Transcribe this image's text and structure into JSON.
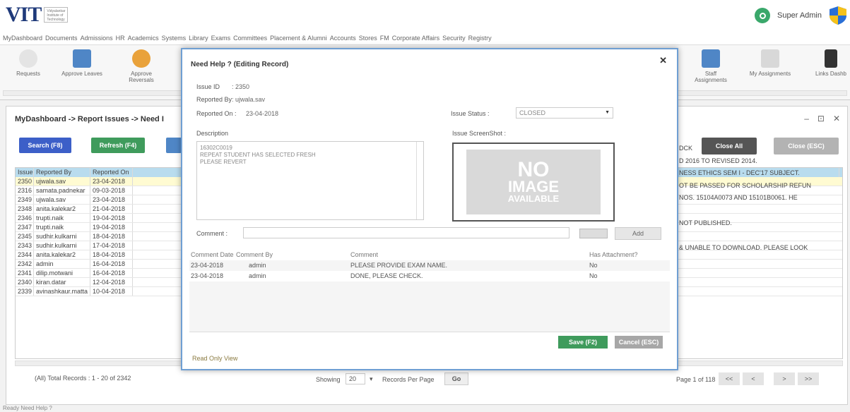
{
  "header": {
    "logo_text": "VIT",
    "logo_sub": "Vidyalankar Institute of Technology",
    "user_name": "Super Admin"
  },
  "menu": [
    "MyDashboard",
    "Documents",
    "Admissions",
    "HR",
    "Academics",
    "Systems",
    "Library",
    "Exams",
    "Committees",
    "Placement & Alumni",
    "Accounts",
    "Stores",
    "FM",
    "Corporate Affairs",
    "Security",
    "Registry"
  ],
  "toolbar": {
    "request": "Requests",
    "approve_leaves": "Approve Leaves",
    "approve_reversals": "Approve Reversals",
    "staff_assignments": "Staff Assignments",
    "my_assignments": "My Assignments",
    "links": "Links Dashb"
  },
  "panel": {
    "breadcrumb": "MyDashboard -> Report Issues -> Need I",
    "search_label": "Search (F8)",
    "refresh_label": "Refresh (F4)",
    "close_all_label": "Close All",
    "close_esc_label": "Close (ESC)",
    "columns": [
      "Issue ID",
      "Reported By",
      "Reported On"
    ],
    "rows": [
      {
        "id": "2350",
        "by": "ujwala.sav",
        "on": "23-04-2018"
      },
      {
        "id": "2316",
        "by": "samata.padnekar",
        "on": "09-03-2018"
      },
      {
        "id": "2349",
        "by": "ujwala.sav",
        "on": "23-04-2018"
      },
      {
        "id": "2348",
        "by": "anita.kalekar2",
        "on": "21-04-2018"
      },
      {
        "id": "2346",
        "by": "trupti.naik",
        "on": "19-04-2018"
      },
      {
        "id": "2347",
        "by": "trupti.naik",
        "on": "19-04-2018"
      },
      {
        "id": "2345",
        "by": "sudhir.kulkarni",
        "on": "18-04-2018"
      },
      {
        "id": "2343",
        "by": "sudhir.kulkarni",
        "on": "17-04-2018"
      },
      {
        "id": "2344",
        "by": "anita.kalekar2",
        "on": "18-04-2018"
      },
      {
        "id": "2342",
        "by": "admin",
        "on": "16-04-2018"
      },
      {
        "id": "2341",
        "by": "dilip.motwani",
        "on": "16-04-2018"
      },
      {
        "id": "2340",
        "by": "kiran.datar",
        "on": "12-04-2018"
      },
      {
        "id": "2339",
        "by": "avinashkaur.matta",
        "on": "10-04-2018"
      }
    ],
    "remarks": [
      "DCK",
      "D 2016 TO REVISED 2014.",
      "NESS ETHICS SEM I - DEC'17 SUBJECT.",
      "OT BE PASSED FOR SCHOLARSHIP REFUN",
      "NOS. 15104A0073 AND 15101B0061. HE",
      "",
      "NOT PUBLISHED.",
      "",
      "& UNABLE TO DOWNLOAD. PLEASE LOOK"
    ],
    "total_records": "(All) Total Records : 1 - 20 of 2342",
    "showing_label": "Showing",
    "page_size": "20",
    "records_per_page": "Records Per Page",
    "go_label": "Go",
    "page_info": "Page 1 of 118"
  },
  "modal": {
    "title": "Need Help ? (Editing Record)",
    "issue_id_label": "Issue ID",
    "issue_id": ": 2350",
    "reported_by_label": "Reported By",
    "reported_by": ": ujwala.sav",
    "reported_on_label": "Reported On :",
    "reported_on": "23-04-2018",
    "issue_status_label": "Issue Status :",
    "issue_status": "CLOSED",
    "description_label": "Description",
    "description_lines": [
      "16302C0019",
      "REPEAT STUDENT HAS SELECTED FRESH",
      "PLEASE REVERT"
    ],
    "screenshot_label": "Issue ScreenShot :",
    "no_image_1": "NO",
    "no_image_2": "IMAGE",
    "no_image_3": "AVAILABLE",
    "comment_label": "Comment :",
    "add_label": "Add",
    "comment_columns": [
      "Comment Date",
      "Comment By",
      "Comment",
      "Has Attachment?"
    ],
    "comments": [
      {
        "date": "23-04-2018",
        "by": "admin",
        "text": "PLEASE PROVIDE EXAM NAME.",
        "att": "No"
      },
      {
        "date": "23-04-2018",
        "by": "admin",
        "text": "DONE, PLEASE CHECK.",
        "att": "No"
      }
    ],
    "save_label": "Save (F2)",
    "cancel_label": "Cancel (ESC)",
    "read_only": "Read Only View"
  },
  "status_bar": "Ready  Need Help ?"
}
